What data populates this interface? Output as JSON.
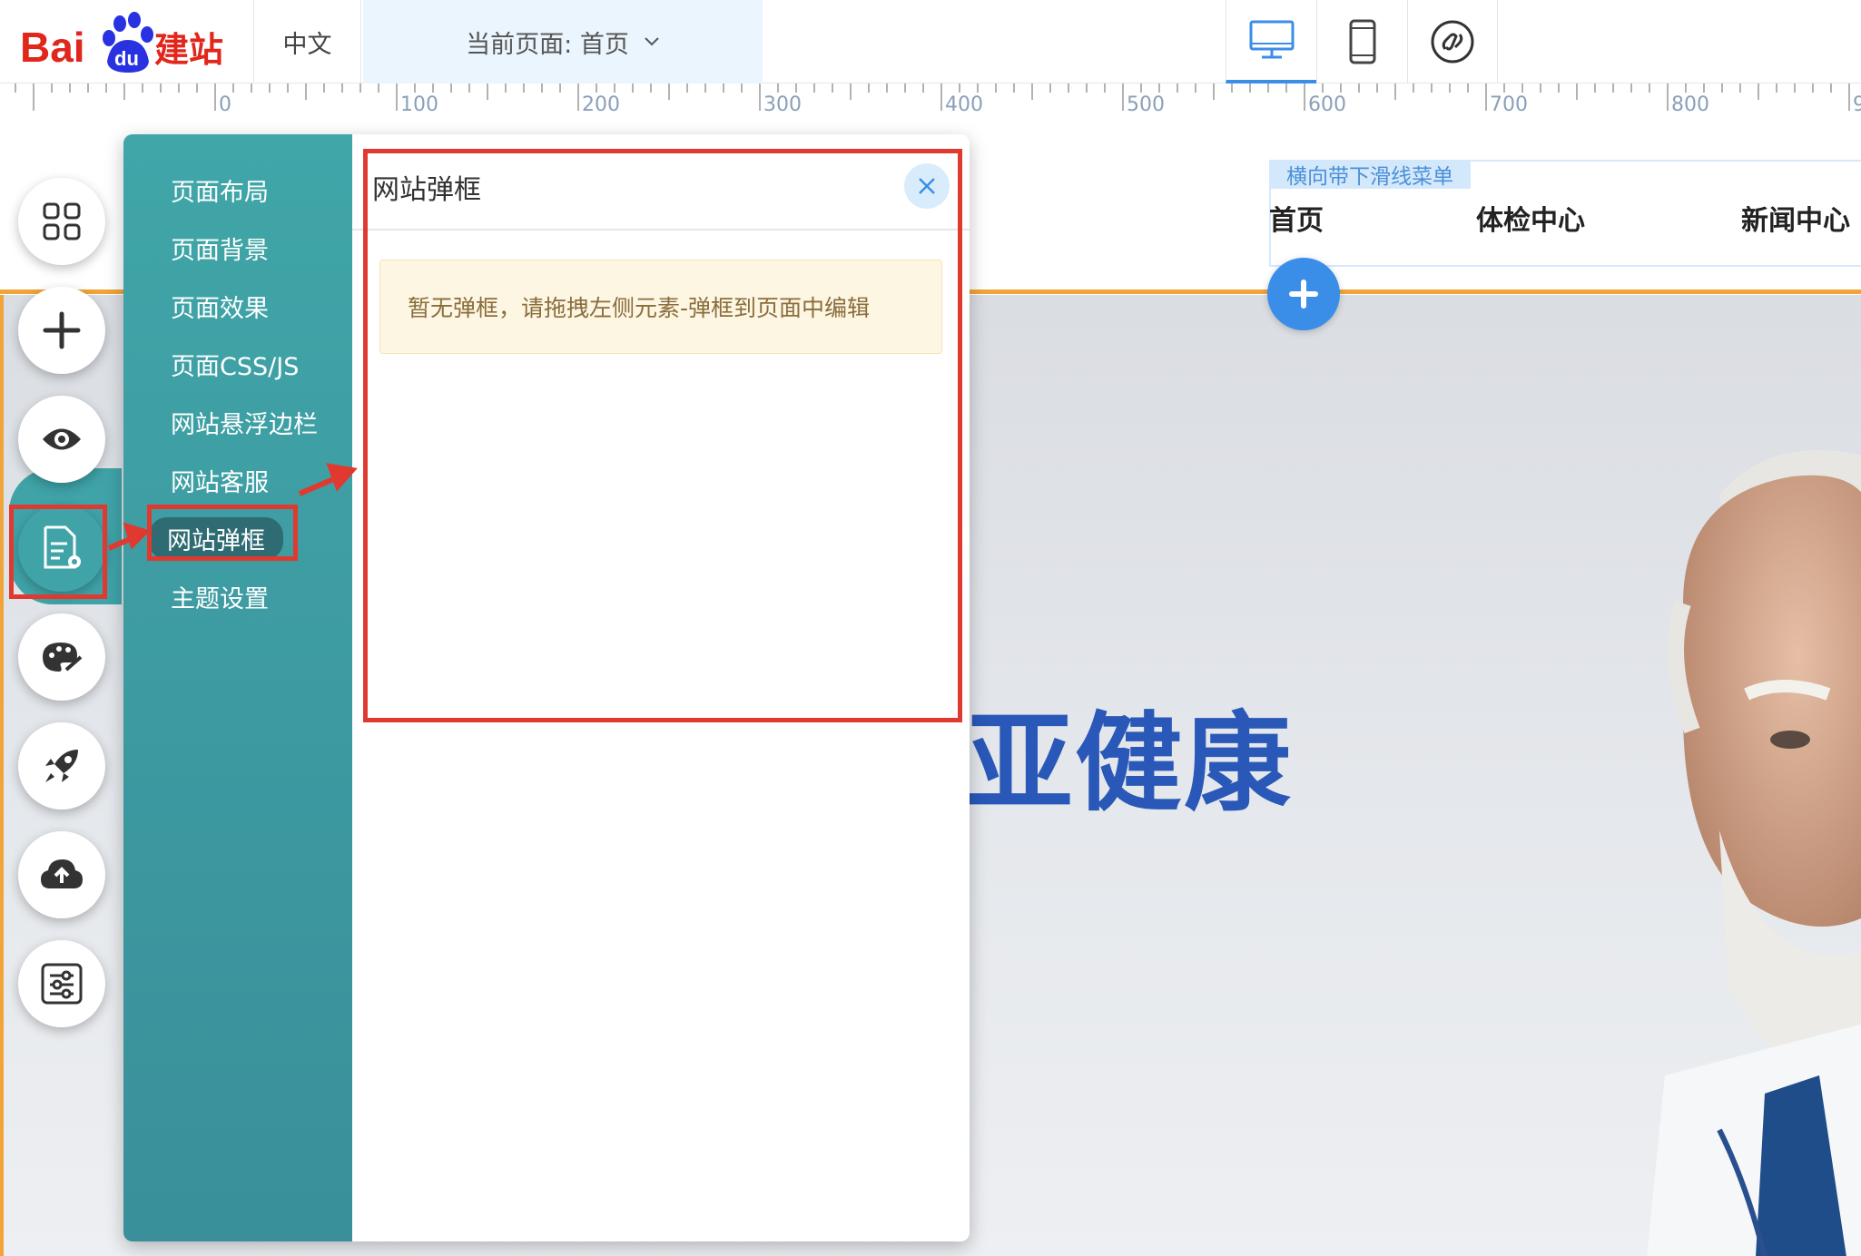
{
  "topbar": {
    "logo_text": "Bai du 建站",
    "language": "中文",
    "page_selector": "当前页面: 首页",
    "devices": [
      "desktop-icon",
      "mobile-icon",
      "mini-program-icon"
    ]
  },
  "ruler": {
    "labels": [
      "0",
      "100",
      "200",
      "300",
      "400",
      "500",
      "600",
      "700",
      "800",
      "9"
    ]
  },
  "canvas": {
    "menu_label": "横向带下滑线菜单",
    "nav_items": [
      "首页",
      "体检中心",
      "新闻中心"
    ],
    "hero_title": "亚健康"
  },
  "tools": [
    "grid-icon",
    "add-icon",
    "preview-icon",
    "page-settings-icon",
    "theme-palette-icon",
    "rocket-icon",
    "cloud-upload-icon",
    "sliders-icon"
  ],
  "panel": {
    "side_items": [
      "页面布局",
      "页面背景",
      "页面效果",
      "页面CSS/JS",
      "网站悬浮边栏",
      "网站客服",
      "网站弹框",
      "主题设置"
    ],
    "active_item": "网站弹框",
    "title": "网站弹框",
    "notice": "暂无弹框，请拖拽左侧元素-弹框到页面中编辑"
  },
  "colors": {
    "accent_blue": "#3b8ee8",
    "panel_teal": "#40a6a8",
    "canvas_border": "#f0a43a",
    "annotation_red": "#e03a30",
    "hero_text": "#2a58b8"
  }
}
